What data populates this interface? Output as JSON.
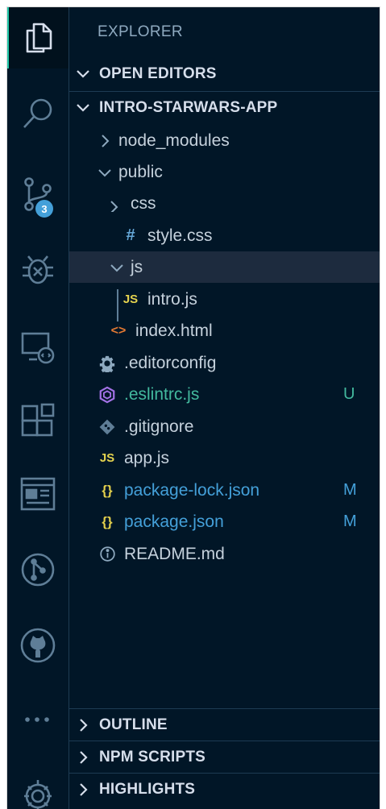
{
  "colors": {
    "background": "#011627",
    "modified": "#44a0d9",
    "untracked": "#43b99e",
    "js_yellow": "#e4d34f",
    "json_yellow": "#e2cf4c",
    "html_orange": "#e37933",
    "css_blue": "#65a8d8",
    "eslint_purple": "#a372e6"
  },
  "activity_bar": {
    "items": [
      {
        "icon": "files-icon"
      },
      {
        "icon": "search-icon"
      },
      {
        "icon": "source-control-icon",
        "badge": "3"
      },
      {
        "icon": "debug-icon"
      },
      {
        "icon": "remote-explorer-icon"
      },
      {
        "icon": "extensions-icon"
      },
      {
        "icon": "browser-preview-icon"
      },
      {
        "icon": "git-graph-icon"
      },
      {
        "icon": "github-icon"
      },
      {
        "icon": "more-icon"
      },
      {
        "icon": "settings-gear-icon"
      }
    ]
  },
  "sidebar": {
    "title": "EXPLORER",
    "open_editors": "OPEN EDITORS",
    "project": "INTRO-STARWARS-APP",
    "tree": [
      {
        "name": "node_modules",
        "type": "folder",
        "state": "collapsed"
      },
      {
        "name": "public",
        "type": "folder",
        "state": "expanded"
      },
      {
        "name": "css",
        "type": "folder",
        "state": "expanded"
      },
      {
        "name": "style.css",
        "type": "css",
        "icon_text": "#"
      },
      {
        "name": "js",
        "type": "folder",
        "state": "expanded"
      },
      {
        "name": "intro.js",
        "type": "js",
        "icon_text": "JS"
      },
      {
        "name": "index.html",
        "type": "html",
        "icon_text": "<>"
      },
      {
        "name": ".editorconfig",
        "type": "config"
      },
      {
        "name": ".eslintrc.js",
        "type": "eslint",
        "status": "U"
      },
      {
        "name": ".gitignore",
        "type": "git"
      },
      {
        "name": "app.js",
        "type": "js",
        "icon_text": "JS"
      },
      {
        "name": "package-lock.json",
        "type": "json",
        "icon_text": "{}",
        "status": "M"
      },
      {
        "name": "package.json",
        "type": "json",
        "icon_text": "{}",
        "status": "M"
      },
      {
        "name": "README.md",
        "type": "info"
      }
    ],
    "bottom_sections": [
      "OUTLINE",
      "NPM SCRIPTS",
      "HIGHLIGHTS"
    ]
  }
}
